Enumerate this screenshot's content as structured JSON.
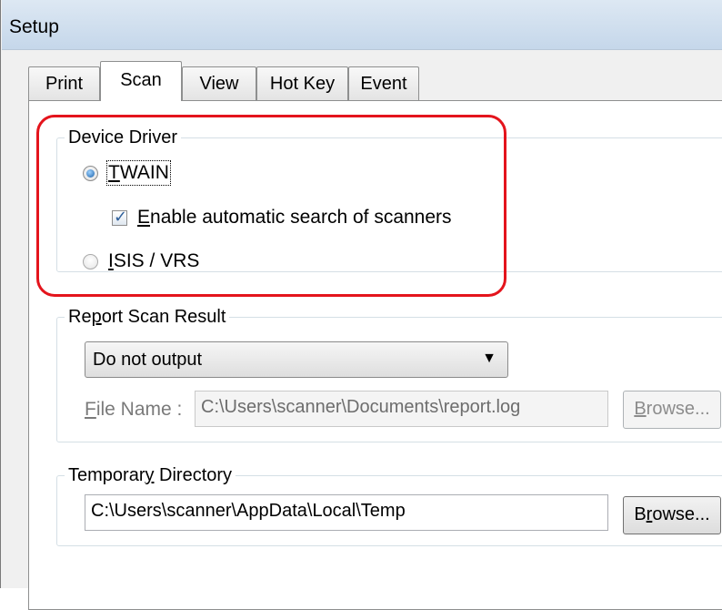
{
  "window": {
    "title": "Setup"
  },
  "tabs": [
    {
      "label": "Print",
      "active": false
    },
    {
      "label": "Scan",
      "active": true
    },
    {
      "label": "View",
      "active": false
    },
    {
      "label": "Hot Key",
      "active": false
    },
    {
      "label": "Event",
      "active": false
    }
  ],
  "device_driver": {
    "title": "Device Driver",
    "twain": {
      "first": "T",
      "rest": "WAIN",
      "checked": true
    },
    "auto_search": {
      "first": "E",
      "rest": "nable automatic search of scanners",
      "checked": true
    },
    "isis": {
      "first": "I",
      "rest": "SIS / VRS",
      "checked": false
    }
  },
  "report_scan": {
    "title_pre": "Re",
    "title_u": "p",
    "title_post": "ort Scan Result",
    "output_select": "Do not output",
    "file_name_label_u": "F",
    "file_name_label_rest": "ile Name :",
    "file_name_value": "C:\\Users\\scanner\\Documents\\report.log",
    "browse_first": "B",
    "browse_rest": "rowse..."
  },
  "temp_dir": {
    "title_pre": "Temporar",
    "title_u": "y",
    "title_post": " Directory",
    "path": "C:\\Users\\scanner\\AppData\\Local\\Temp",
    "browse_pre": "B",
    "browse_u": "r",
    "browse_post": "owse..."
  },
  "colors": {
    "highlight": "#e4141c",
    "accent": "#1a5fa8"
  }
}
